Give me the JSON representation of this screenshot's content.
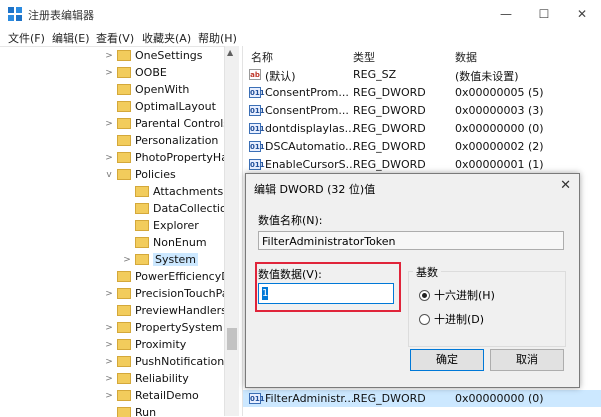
{
  "window": {
    "title": "注册表编辑器",
    "minimize": "—",
    "maximize": "☐",
    "close": "✕"
  },
  "menu": [
    "文件(F)",
    "编辑(E)",
    "查看(V)",
    "收藏夹(A)",
    "帮助(H)"
  ],
  "tree": [
    {
      "label": "OneSettings",
      "expander": ">"
    },
    {
      "label": "OOBE",
      "expander": ">"
    },
    {
      "label": "OpenWith",
      "expander": ""
    },
    {
      "label": "OptimalLayout",
      "expander": ""
    },
    {
      "label": "Parental Controls",
      "expander": ">"
    },
    {
      "label": "Personalization",
      "expander": ""
    },
    {
      "label": "PhotoPropertyHa",
      "expander": ">"
    },
    {
      "label": "Policies",
      "expander": "v"
    },
    {
      "label": "Attachments",
      "expander": ""
    },
    {
      "label": "DataCollection",
      "expander": ""
    },
    {
      "label": "Explorer",
      "expander": ""
    },
    {
      "label": "NonEnum",
      "expander": ""
    },
    {
      "label": "System",
      "expander": ">"
    },
    {
      "label": "PowerEfficiencyDi",
      "expander": ""
    },
    {
      "label": "PrecisionTouchPa",
      "expander": ">"
    },
    {
      "label": "PreviewHandlers",
      "expander": ""
    },
    {
      "label": "PropertySystem",
      "expander": ">"
    },
    {
      "label": "Proximity",
      "expander": ">"
    },
    {
      "label": "PushNotifications",
      "expander": ">"
    },
    {
      "label": "Reliability",
      "expander": ">"
    },
    {
      "label": "RetailDemo",
      "expander": ">"
    },
    {
      "label": "Run",
      "expander": ""
    }
  ],
  "list": {
    "headers": [
      "名称",
      "类型",
      "数据"
    ],
    "rows": [
      {
        "icon": "ab",
        "name": "(默认)",
        "type": "REG_SZ",
        "data": "(数值未设置)"
      },
      {
        "icon": "bin",
        "name": "ConsentProm...",
        "type": "REG_DWORD",
        "data": "0x00000005 (5)"
      },
      {
        "icon": "bin",
        "name": "ConsentProm...",
        "type": "REG_DWORD",
        "data": "0x00000003 (3)"
      },
      {
        "icon": "bin",
        "name": "dontdisplaylas...",
        "type": "REG_DWORD",
        "data": "0x00000000 (0)"
      },
      {
        "icon": "bin",
        "name": "DSCAutomatio...",
        "type": "REG_DWORD",
        "data": "0x00000002 (2)"
      },
      {
        "icon": "bin",
        "name": "EnableCursorS...",
        "type": "REG_DWORD",
        "data": "0x00000001 (1)"
      }
    ],
    "bottom_row": {
      "icon": "bin",
      "name": "FilterAdministr...",
      "type": "REG_DWORD",
      "data": "0x00000000 (0)"
    }
  },
  "dialog": {
    "title": "编辑 DWORD (32 位)值",
    "close": "✕",
    "value_name_label": "数值名称(N):",
    "value_name": "FilterAdministratorToken",
    "value_data_label": "数值数据(V):",
    "value_data": "1",
    "base_label": "基数",
    "hex_label": "十六进制(H)",
    "dec_label": "十进制(D)",
    "base_selected": "hex",
    "ok": "确定",
    "cancel": "取消"
  },
  "colors": {
    "highlight": "#e0243a",
    "accent": "#0078d7",
    "folder": "#f2cc5c"
  }
}
